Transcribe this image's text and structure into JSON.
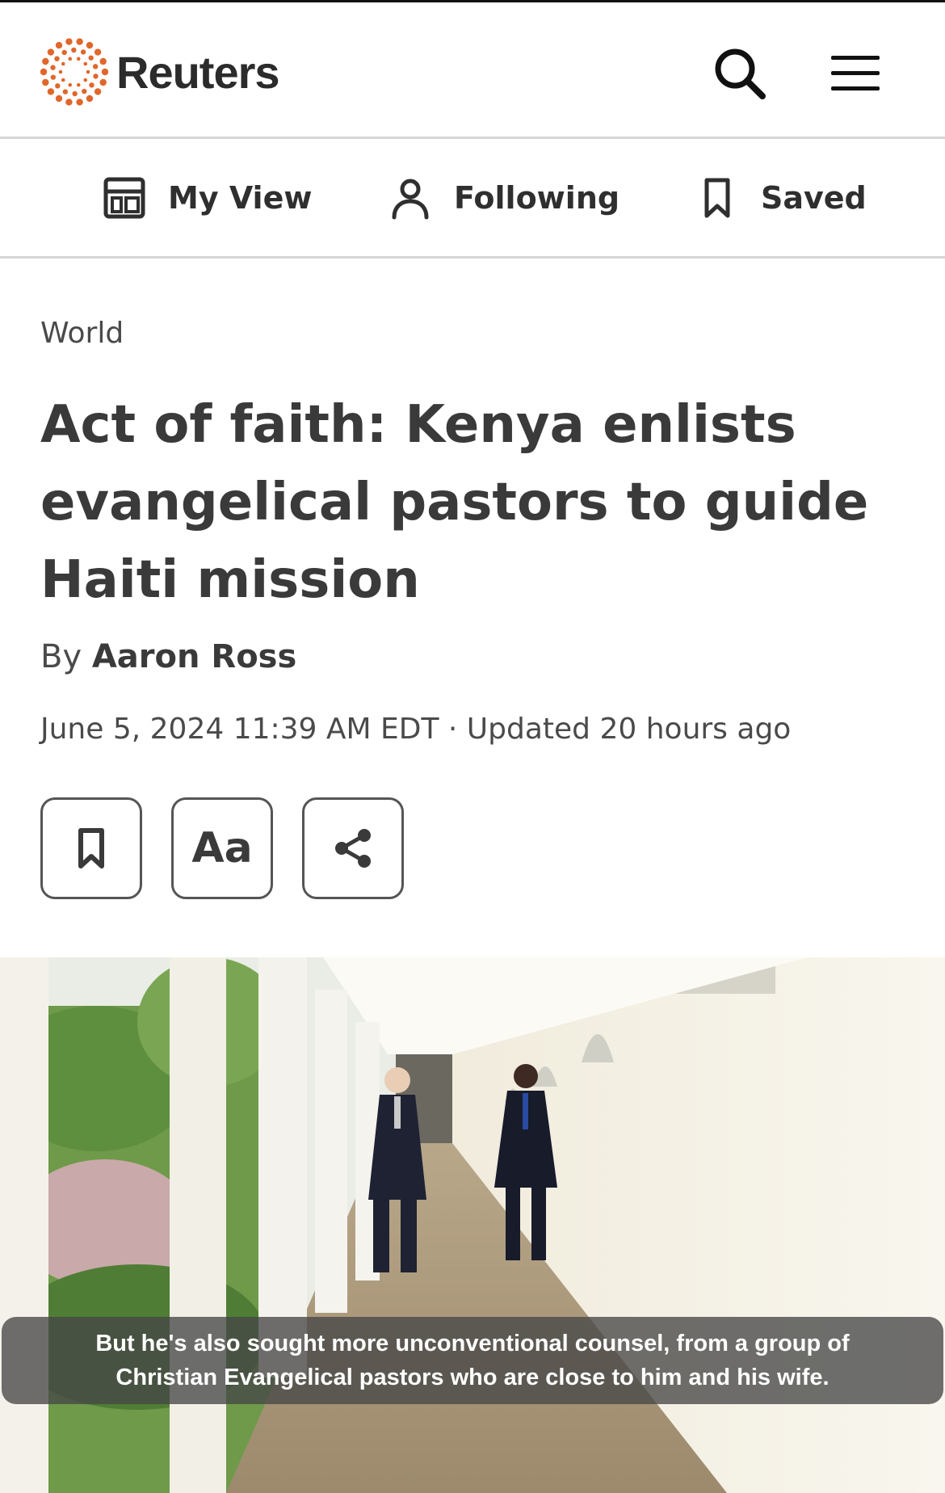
{
  "header": {
    "brand": "Reuters",
    "logo_icon": "reuters-dotted-logo-icon",
    "search_icon": "search-icon",
    "menu_icon": "hamburger-menu-icon",
    "accent_color": "#e0672c"
  },
  "nav": {
    "items": [
      {
        "label": "My View",
        "icon": "layout-icon"
      },
      {
        "label": "Following",
        "icon": "person-icon"
      },
      {
        "label": "Saved",
        "icon": "bookmark-icon"
      }
    ]
  },
  "article": {
    "section": "World",
    "headline": "Act of faith: Kenya enlists evangelical pastors to guide Haiti mission",
    "byline_prefix": "By",
    "author": "Aaron Ross",
    "dateline": "June 5, 2024 11:39 AM EDT · Updated 20 hours ago",
    "tools": [
      {
        "icon": "bookmark-icon"
      },
      {
        "label": "Aa",
        "icon": "text-size-icon"
      },
      {
        "icon": "share-icon"
      }
    ]
  },
  "media": {
    "caption": "But he's also sought more unconventional counsel, from a group of Christian Evangelical pastors who are close to him and his wife."
  }
}
